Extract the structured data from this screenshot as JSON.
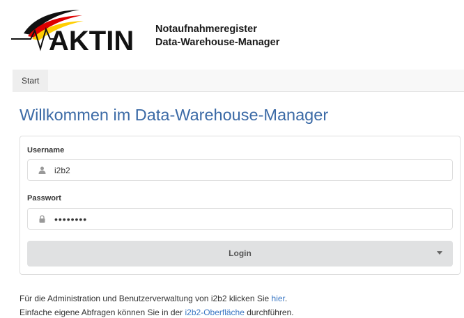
{
  "header": {
    "logo_text": "AKTIN",
    "title_line1": "Notaufnahmeregister",
    "title_line2": "Data-Warehouse-Manager"
  },
  "nav": {
    "start_label": "Start"
  },
  "main": {
    "welcome": "Willkommen im Data-Warehouse-Manager",
    "username_label": "Username",
    "username_value": "i2b2",
    "password_label": "Passwort",
    "password_value": "••••••••",
    "login_label": "Login"
  },
  "info": {
    "line1_prefix": "Für die Administration und Benutzerverwaltung von i2b2 klicken Sie ",
    "line1_link": "hier",
    "line1_suffix": ".",
    "line2_prefix": "Einfache eigene Abfragen können Sie in der ",
    "line2_link": "i2b2-Oberfläche",
    "line2_suffix": " durchführen."
  },
  "icons": {
    "username": "user-icon",
    "password": "lock-icon",
    "dropdown": "caret-down-icon"
  },
  "colors": {
    "accent": "#3b6aa6",
    "link": "#3b78c4",
    "flag_black": "#111111",
    "flag_red": "#dd0000",
    "flag_gold": "#ffce00"
  }
}
